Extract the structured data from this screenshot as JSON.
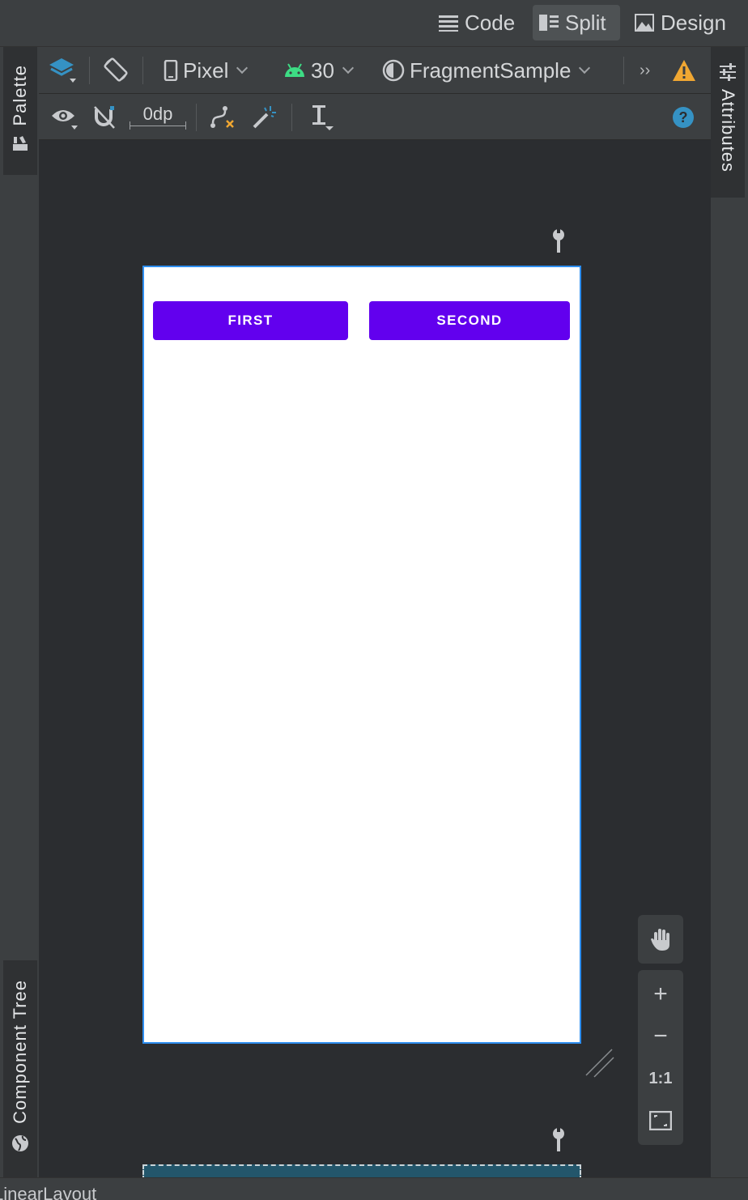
{
  "view_modes": {
    "code_label": "Code",
    "split_label": "Split",
    "design_label": "Design",
    "active": "Split"
  },
  "side_panels": {
    "palette_label": "Palette",
    "component_tree_label": "Component Tree",
    "attributes_label": "Attributes"
  },
  "toolbar": {
    "device_label": "Pixel",
    "api_level_label": "30",
    "theme_label": "FragmentSample",
    "overflow_label": "››",
    "margin_label": "0dp"
  },
  "phone_preview": {
    "first_button_label": "FIRST",
    "second_button_label": "SECOND",
    "button_color": "#6200ee"
  },
  "zoom_controls": {
    "zoom_in_label": "+",
    "zoom_out_label": "−",
    "actual_size_label": "1:1"
  },
  "status_bar": {
    "text": "LinearLayout"
  },
  "colors": {
    "accent_blue": "#2e8ef0",
    "warning_orange": "#f0a732",
    "help_blue": "#3592c4",
    "android_green": "#3ddc84"
  }
}
